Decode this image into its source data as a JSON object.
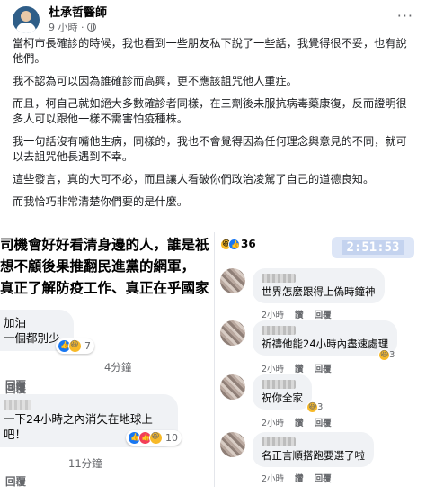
{
  "post": {
    "author": "杜承哲醫師",
    "time": "9 小時 ·",
    "paragraphs": [
      "當柯市長確診的時候，我也看到一些朋友私下說了一些話，我覺得很不妥，也有說他們。",
      "我不認為可以因為誰確診而高興，更不應該詛咒他人重症。",
      "而且，柯自己就如絕大多數確診者同樣，在三劑後未服抗病毒藥康復，反而證明很多人可以跟他一樣不需害怕疫種株。",
      "我一句話沒有嘴他生病，同樣的，我也不會覺得因為任何理念與意見的不同，就可以去詛咒他長遇到不幸。",
      "這些發言，真的大可不必，而且讓人看破你們政治凌駕了自己的道德良知。",
      "而我恰巧非常清楚你們要的是什麼。"
    ]
  },
  "left_screenshot": {
    "caption_lines": [
      "司機會好好看清身邊的人，誰是衹",
      "想不顧後果推翻民進黨的網軍，",
      "真正了解防疫工作、真正在乎國家"
    ],
    "comments": [
      {
        "lines": [
          "加油",
          "一個都別少"
        ],
        "reaction_count": "7",
        "time": "4分鐘",
        "reply_label": "回覆"
      },
      {
        "lines": [
          "一下24小時之內消失在地球上吧！"
        ],
        "reaction_count": "10",
        "time": "11分鐘",
        "reply_label": "回覆"
      }
    ],
    "tail_reply_label": "回覆",
    "top_reply_label": "回覆"
  },
  "right_screenshot": {
    "reaction_count": "36",
    "timer": "2:51:53",
    "comments": [
      {
        "text": "世界怎麼跟得上偽時鐘神",
        "time": "2小時",
        "like": "讚",
        "reply": "回覆"
      },
      {
        "text": "祈禱他能24小時內盡速處理",
        "time": "2小時",
        "like": "讚",
        "reply": "回覆",
        "reaction_count": "3"
      },
      {
        "text": "祝你全家",
        "time": "2小時",
        "like": "讚",
        "reply": "回覆",
        "reaction_count": "3"
      },
      {
        "text": "名正言順搭跑要選了啦",
        "time": "2小時",
        "like": "讚",
        "reply": "回覆"
      }
    ]
  },
  "colors": {
    "facebook_blue": "#1877f2",
    "secondary_text": "#65676b",
    "bubble_bg": "#f0f2f5",
    "haha_yellow": "#f7b928"
  }
}
